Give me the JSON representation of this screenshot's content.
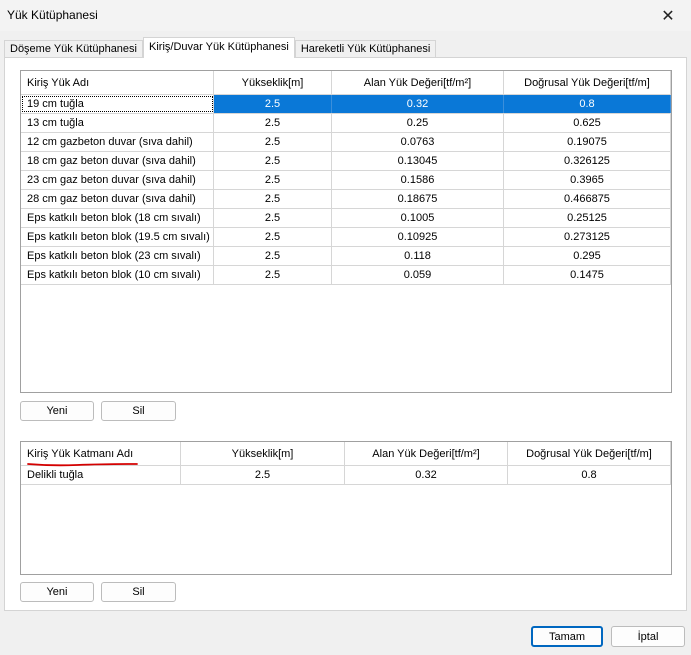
{
  "window": {
    "title": "Yük Kütüphanesi",
    "close_glyph": "✕"
  },
  "tabs": [
    {
      "label": "Döşeme Yük Kütüphanesi"
    },
    {
      "label": "Kiriş/Duvar Yük Kütüphanesi"
    },
    {
      "label": "Hareketli Yük Kütüphanesi"
    }
  ],
  "active_tab": 1,
  "top_grid": {
    "headers": [
      "Kiriş Yük Adı",
      "Yükseklik[m]",
      "Alan Yük Değeri[tf/m²]",
      "Doğrusal Yük Değeri[tf/m]"
    ],
    "rows": [
      [
        "19 cm tuğla",
        "2.5",
        "0.32",
        "0.8"
      ],
      [
        "13 cm tuğla",
        "2.5",
        "0.25",
        "0.625"
      ],
      [
        "12 cm gazbeton duvar (sıva dahil)",
        "2.5",
        "0.0763",
        "0.19075"
      ],
      [
        "18 cm gaz beton duvar (sıva dahil)",
        "2.5",
        "0.13045",
        "0.326125"
      ],
      [
        "23 cm gaz beton duvar  (sıva dahil)",
        "2.5",
        "0.1586",
        "0.3965"
      ],
      [
        "28 cm gaz beton duvar  (sıva dahil)",
        "2.5",
        "0.18675",
        "0.466875"
      ],
      [
        "Eps katkılı beton blok (18 cm sıvalı)",
        "2.5",
        "0.1005",
        "0.25125"
      ],
      [
        "Eps katkılı beton blok (19.5 cm sıvalı)",
        "2.5",
        "0.10925",
        "0.273125"
      ],
      [
        "Eps katkılı beton blok (23 cm sıvalı)",
        "2.5",
        "0.118",
        "0.295"
      ],
      [
        "Eps katkılı beton blok (10 cm sıvalı)",
        "2.5",
        "0.059",
        "0.1475"
      ]
    ],
    "selected_row": 0
  },
  "top_buttons": {
    "new": "Yeni",
    "delete": "Sil"
  },
  "bottom_grid": {
    "headers": [
      "Kiriş Yük Katmanı Adı",
      "Yükseklik[m]",
      "Alan Yük Değeri[tf/m²]",
      "Doğrusal Yük Değeri[tf/m]"
    ],
    "rows": [
      [
        "Delikli tuğla",
        "2.5",
        "0.32",
        "0.8"
      ]
    ]
  },
  "bottom_buttons": {
    "new": "Yeni",
    "delete": "Sil"
  },
  "dialog_buttons": {
    "ok": "Tamam",
    "cancel": "İptal"
  },
  "colors": {
    "selection": "#0a78d7",
    "underline_mark": "#d40000",
    "primary_border": "#0067c0"
  }
}
